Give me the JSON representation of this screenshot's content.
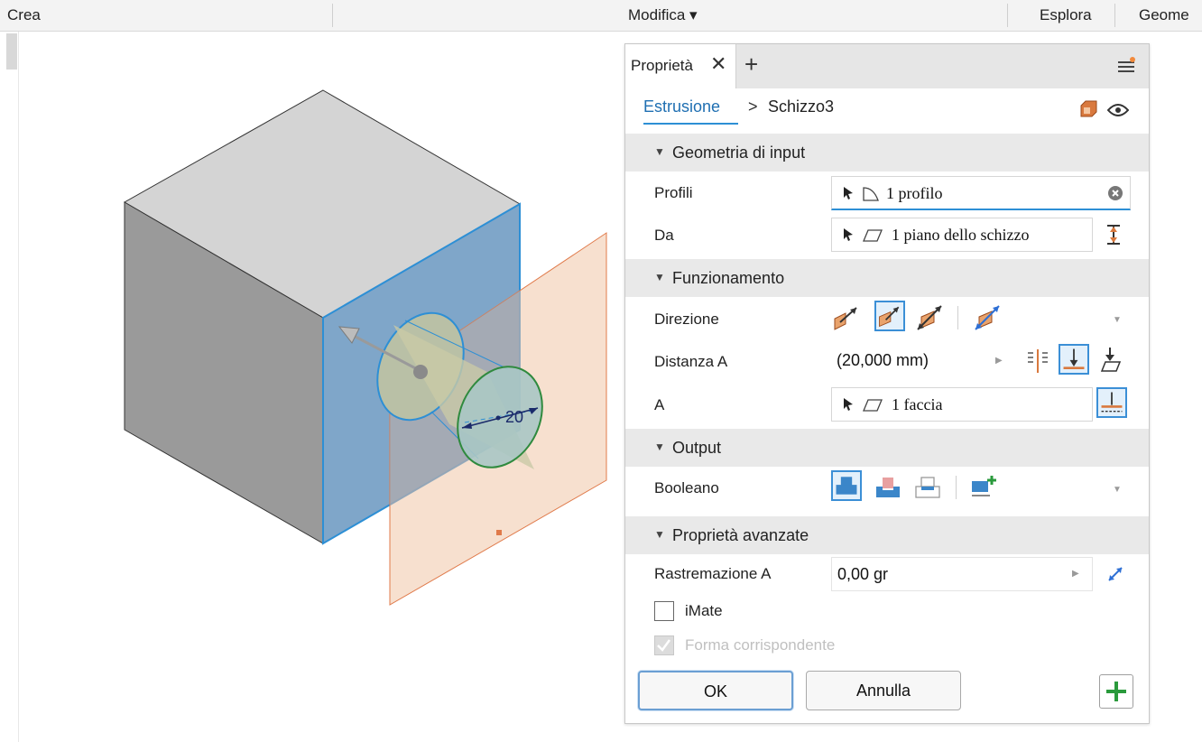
{
  "ribbon": {
    "crea": "Crea",
    "modifica": "Modifica ▾",
    "esplora": "Esplora",
    "geometria": "Geome"
  },
  "viewport": {
    "dimension_value": "20",
    "colors": {
      "face_selected": "#7fa6c9",
      "sketch_plane": "#f0c7a8",
      "highlight": "#2d8fd5"
    }
  },
  "panel": {
    "tab_title": "Proprietà",
    "breadcrumb": {
      "feature": "Estrusione",
      "separator": ">",
      "sketch": "Schizzo3"
    },
    "sections": {
      "input": {
        "title": "Geometria di input",
        "profili_label": "Profili",
        "profili_value": "1 profilo",
        "da_label": "Da",
        "da_value": "1 piano dello schizzo"
      },
      "funzionamento": {
        "title": "Funzionamento",
        "direzione_label": "Direzione",
        "distanza_label": "Distanza A",
        "distanza_value": "(20,000 mm)",
        "a_label": "A",
        "a_value": "1 faccia"
      },
      "output": {
        "title": "Output",
        "booleano_label": "Booleano"
      },
      "avanzate": {
        "title": "Proprietà avanzate",
        "rastremazione_label": "Rastremazione A",
        "rastremazione_value": "0,00 gr",
        "imate_label": "iMate",
        "imate_checked": false,
        "forma_label": "Forma corrispondente",
        "forma_checked": true,
        "forma_disabled": true
      }
    },
    "buttons": {
      "ok": "OK",
      "cancel": "Annulla"
    },
    "accent": "#2d8fd5"
  }
}
